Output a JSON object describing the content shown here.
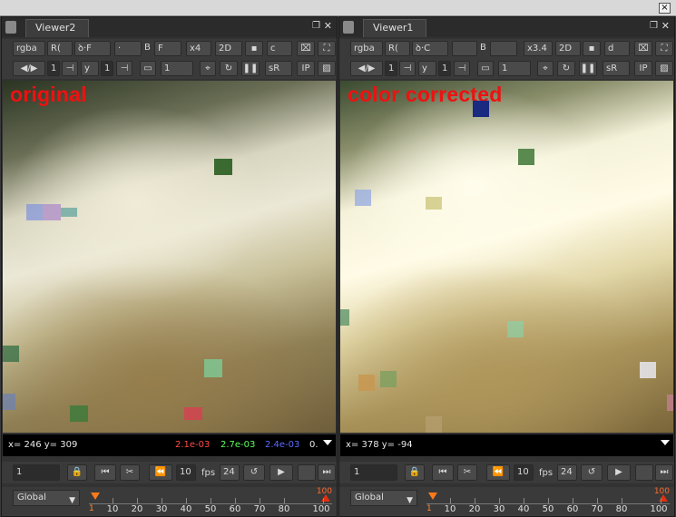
{
  "window": {
    "close_glyph": "×"
  },
  "panes": [
    {
      "tab": "Viewer2",
      "tb1": {
        "channels": "rgba",
        "chan_a": "R(",
        "chan_b": "ꝺ·F",
        "input_a": "·",
        "b_label": "B",
        "input_b": "F",
        "zoom": "x4",
        "view": "2D",
        "cam": "c"
      },
      "tb2": {
        "gain_val": "1",
        "gamma_label": "y",
        "gamma_val": "1",
        "proxy": "1",
        "lut": "sR",
        "ip": "IP"
      },
      "label": "original",
      "info": {
        "coords": "x= 246 y= 309",
        "r": "2.1e-03",
        "g": "2.7e-03",
        "b": "2.4e-03",
        "a": "0."
      },
      "play": {
        "frame": "1",
        "step": "10",
        "fps_label": "fps",
        "fps": "24"
      },
      "timeline": {
        "mode": "Global",
        "ticks": [
          "10",
          "20",
          "30",
          "40",
          "50",
          "60",
          "70",
          "80",
          "100"
        ],
        "end": "100",
        "start": "1"
      }
    },
    {
      "tab": "Viewer1",
      "tb1": {
        "channels": "rgba",
        "chan_a": "R(",
        "chan_b": "ꝺ·C",
        "input_a": "",
        "b_label": "B",
        "input_b": "",
        "zoom": "x3.4",
        "view": "2D",
        "cam": "d"
      },
      "tb2": {
        "gain_val": "1",
        "gamma_label": "y",
        "gamma_val": "1",
        "proxy": "1",
        "lut": "sR",
        "ip": "IP"
      },
      "label": "color corrected",
      "info": {
        "coords": "x= 378 y= -94",
        "r": "",
        "g": "",
        "b": "",
        "a": ""
      },
      "play": {
        "frame": "1",
        "step": "10",
        "fps_label": "fps",
        "fps": "24"
      },
      "timeline": {
        "mode": "Global",
        "ticks": [
          "10",
          "20",
          "30",
          "40",
          "50",
          "60",
          "70",
          "80",
          "100"
        ],
        "end": "100",
        "start": "1"
      }
    }
  ],
  "colors": {
    "label_red": "#ee1111",
    "red_channel": "#ff4a4a",
    "green_channel": "#5dff5d",
    "blue_channel": "#5a6bff",
    "timeline_marker": "#ff7a1a"
  }
}
